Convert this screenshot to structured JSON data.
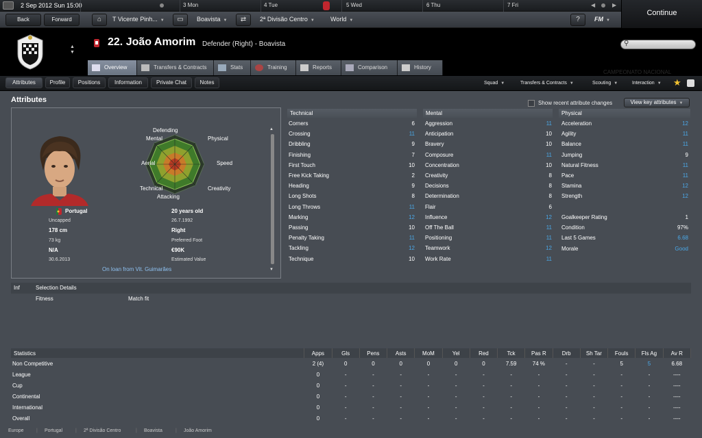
{
  "calendar": {
    "date": "2 Sep 2012 Sun 15:00",
    "days": [
      "3 Mon",
      "4 Tue",
      "5 Wed",
      "6 Thu",
      "7 Fri"
    ]
  },
  "nav": {
    "back": "Back",
    "forward": "Forward",
    "manager": "T Vicente Pinh...",
    "club": "Boavista",
    "division": "2ª Divisão Centro",
    "world": "World",
    "continue": "Continue",
    "help": "?",
    "fm": "FM"
  },
  "header": {
    "name": "22. João Amorim",
    "role": "Defender (Right) - Boavista",
    "watermark": "CAMPEONATO NACIONAL"
  },
  "tabs": [
    {
      "label": "Overview"
    },
    {
      "label": "Transfers & Contracts"
    },
    {
      "label": "Stats"
    },
    {
      "label": "Training"
    },
    {
      "label": "Reports"
    },
    {
      "label": "Comparison"
    },
    {
      "label": "History"
    }
  ],
  "subnav": {
    "buttons": [
      "Attributes",
      "Profile",
      "Positions",
      "Information",
      "Private Chat",
      "Notes"
    ],
    "menus": [
      "Squad",
      "Transfers & Contracts",
      "Scouting",
      "Interaction"
    ]
  },
  "section_title": "Attributes",
  "recent_changes_label": "Show recent attribute changes",
  "key_attributes_label": "View key attributes",
  "radar": {
    "labels": [
      "Defending",
      "Physical",
      "Speed",
      "Creativity",
      "Attacking",
      "Technical",
      "Aerial",
      "Mental"
    ]
  },
  "profile": {
    "nationality": "Portugal",
    "caps": "Uncapped",
    "height": "178 cm",
    "weight": "73 kg",
    "unknown": "N/A",
    "contract_date": "30.6.2013",
    "age": "20 years old",
    "dob": "26.7.1992",
    "foot": "Right",
    "foot_label": "Preferred Foot",
    "value": "€90K",
    "value_label": "Estimated Value",
    "loan": "On loan from Vit. Guimarães"
  },
  "technical": {
    "title": "Technical",
    "rows": [
      {
        "name": "Corners",
        "value": "6"
      },
      {
        "name": "Crossing",
        "value": "11"
      },
      {
        "name": "Dribbling",
        "value": "9"
      },
      {
        "name": "Finishing",
        "value": "7"
      },
      {
        "name": "First Touch",
        "value": "10"
      },
      {
        "name": "Free Kick Taking",
        "value": "2"
      },
      {
        "name": "Heading",
        "value": "9"
      },
      {
        "name": "Long Shots",
        "value": "8"
      },
      {
        "name": "Long Throws",
        "value": "11"
      },
      {
        "name": "Marking",
        "value": "12"
      },
      {
        "name": "Passing",
        "value": "10"
      },
      {
        "name": "Penalty Taking",
        "value": "11"
      },
      {
        "name": "Tackling",
        "value": "12"
      },
      {
        "name": "Technique",
        "value": "10"
      }
    ]
  },
  "mental": {
    "title": "Mental",
    "rows": [
      {
        "name": "Aggression",
        "value": "11"
      },
      {
        "name": "Anticipation",
        "value": "10"
      },
      {
        "name": "Bravery",
        "value": "10"
      },
      {
        "name": "Composure",
        "value": "11"
      },
      {
        "name": "Concentration",
        "value": "10"
      },
      {
        "name": "Creativity",
        "value": "8"
      },
      {
        "name": "Decisions",
        "value": "8"
      },
      {
        "name": "Determination",
        "value": "8"
      },
      {
        "name": "Flair",
        "value": "6"
      },
      {
        "name": "Influence",
        "value": "12"
      },
      {
        "name": "Off The Ball",
        "value": "11"
      },
      {
        "name": "Positioning",
        "value": "11"
      },
      {
        "name": "Teamwork",
        "value": "12"
      },
      {
        "name": "Work Rate",
        "value": "11"
      }
    ]
  },
  "physical": {
    "title": "Physical",
    "rows": [
      {
        "name": "Acceleration",
        "value": "12"
      },
      {
        "name": "Agility",
        "value": "11"
      },
      {
        "name": "Balance",
        "value": "11"
      },
      {
        "name": "Jumping",
        "value": "9"
      },
      {
        "name": "Natural Fitness",
        "value": "11"
      },
      {
        "name": "Pace",
        "value": "11"
      },
      {
        "name": "Stamina",
        "value": "12"
      },
      {
        "name": "Strength",
        "value": "12"
      }
    ],
    "extra": [
      {
        "name": "Goalkeeper Rating",
        "value": "1"
      },
      {
        "name": "Condition",
        "value": "97%"
      },
      {
        "name": "Last 5 Games",
        "value": "6.68"
      },
      {
        "name": "Morale",
        "value": "Good"
      }
    ]
  },
  "selection": {
    "inf": "Inf",
    "title": "Selection Details",
    "fitness": "Fitness",
    "match_fit": "Match fit"
  },
  "statistics": {
    "headers": [
      "Statistics",
      "Apps",
      "Gls",
      "Pens",
      "Asts",
      "MoM",
      "Yel",
      "Red",
      "Tck",
      "Pas R",
      "Drb",
      "Sh Tar",
      "Fouls",
      "Fls Ag",
      "Av R"
    ],
    "rows": [
      [
        "Non Competitive",
        "2 (4)",
        "0",
        "0",
        "0",
        "0",
        "0",
        "0",
        "7.59",
        "74 %",
        "-",
        "-",
        "5",
        "5",
        "6.68"
      ],
      [
        "League",
        "0",
        "-",
        "-",
        "-",
        "-",
        "-",
        "-",
        "-",
        "-",
        "-",
        "-",
        "-",
        "-",
        "----"
      ],
      [
        "Cup",
        "0",
        "-",
        "-",
        "-",
        "-",
        "-",
        "-",
        "-",
        "-",
        "-",
        "-",
        "-",
        "-",
        "----"
      ],
      [
        "Continental",
        "0",
        "-",
        "-",
        "-",
        "-",
        "-",
        "-",
        "-",
        "-",
        "-",
        "-",
        "-",
        "-",
        "----"
      ],
      [
        "International",
        "0",
        "-",
        "-",
        "-",
        "-",
        "-",
        "-",
        "-",
        "-",
        "-",
        "-",
        "-",
        "-",
        "----"
      ],
      [
        "Overall",
        "0",
        "-",
        "-",
        "-",
        "-",
        "-",
        "-",
        "-",
        "-",
        "-",
        "-",
        "-",
        "-",
        "----"
      ]
    ]
  },
  "breadcrumb": [
    "Europe",
    "Portugal",
    "2ª Divisão Centro",
    "Boavista",
    "João Amorim"
  ],
  "colors": {
    "accent_blue": "#4aa8e8",
    "club_red": "#c0262e"
  }
}
